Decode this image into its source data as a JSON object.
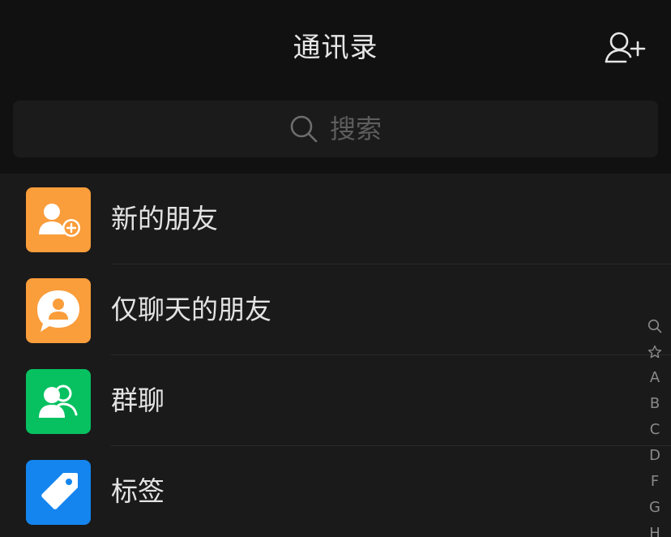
{
  "header": {
    "title": "通讯录",
    "add_contact_icon": "add-contact-icon"
  },
  "search": {
    "placeholder": "搜索",
    "icon": "search-icon"
  },
  "list": {
    "items": [
      {
        "label": "新的朋友",
        "icon": "add-friend-icon",
        "color": "#fa9d3b"
      },
      {
        "label": "仅聊天的朋友",
        "icon": "chat-only-friend-icon",
        "color": "#fa9d3b"
      },
      {
        "label": "群聊",
        "icon": "group-chat-icon",
        "color": "#07c160"
      },
      {
        "label": "标签",
        "icon": "tag-icon",
        "color": "#1485ee"
      }
    ]
  },
  "index_bar": {
    "items": [
      "search",
      "star",
      "A",
      "B",
      "C",
      "D",
      "F",
      "G",
      "H"
    ]
  },
  "colors": {
    "background": "#111111",
    "list_background": "#1a1a1a",
    "text_primary": "#e3e3e3",
    "placeholder": "#5d5d5d",
    "index_text": "#8a8a8a"
  }
}
